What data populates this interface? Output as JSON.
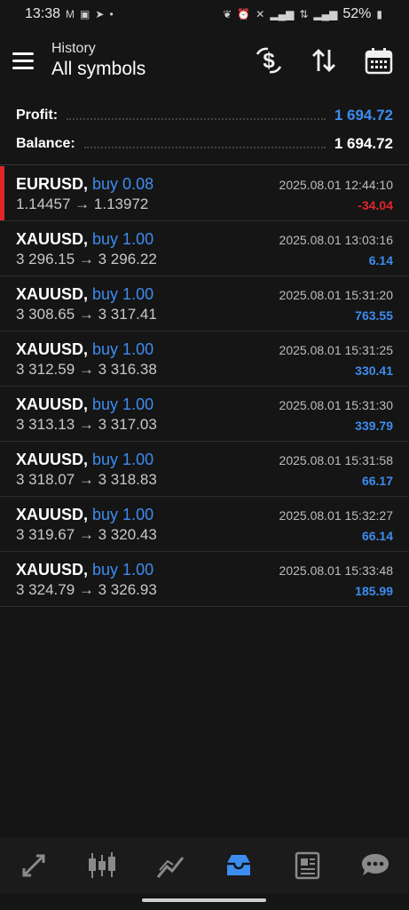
{
  "status_bar": {
    "time": "13:38",
    "battery": "52%",
    "left_icons": [
      "gmail-icon",
      "fxs-icon",
      "telegram-icon",
      "dot-icon"
    ],
    "right_icons": [
      "leaf-icon",
      "alarm-icon",
      "mute-icon",
      "signal-icon",
      "volte-icon",
      "4g-icon",
      "signal-icon",
      "battery-icon"
    ]
  },
  "header": {
    "subtitle": "History",
    "title": "All symbols",
    "actions": [
      "currency-swap-icon",
      "sort-icon",
      "calendar-icon"
    ]
  },
  "summary": {
    "profit_label": "Profit:",
    "profit_value": "1 694.72",
    "balance_label": "Balance:",
    "balance_value": "1 694.72"
  },
  "colors": {
    "positive": "#3d8cf0",
    "negative": "#e0262a",
    "background": "#151515"
  },
  "trades": [
    {
      "symbol": "EURUSD,",
      "side": "buy 0.08",
      "time": "2025.08.01 12:44:10",
      "prices": "1.14457 → 1.13972",
      "profit": "-34.04",
      "negative": true
    },
    {
      "symbol": "XAUUSD,",
      "side": "buy 1.00",
      "time": "2025.08.01 13:03:16",
      "prices": "3 296.15 → 3 296.22",
      "profit": "6.14",
      "negative": false
    },
    {
      "symbol": "XAUUSD,",
      "side": "buy 1.00",
      "time": "2025.08.01 15:31:20",
      "prices": "3 308.65 → 3 317.41",
      "profit": "763.55",
      "negative": false
    },
    {
      "symbol": "XAUUSD,",
      "side": "buy 1.00",
      "time": "2025.08.01 15:31:25",
      "prices": "3 312.59 → 3 316.38",
      "profit": "330.41",
      "negative": false
    },
    {
      "symbol": "XAUUSD,",
      "side": "buy 1.00",
      "time": "2025.08.01 15:31:30",
      "prices": "3 313.13 → 3 317.03",
      "profit": "339.79",
      "negative": false
    },
    {
      "symbol": "XAUUSD,",
      "side": "buy 1.00",
      "time": "2025.08.01 15:31:58",
      "prices": "3 318.07 → 3 318.83",
      "profit": "66.17",
      "negative": false
    },
    {
      "symbol": "XAUUSD,",
      "side": "buy 1.00",
      "time": "2025.08.01 15:32:27",
      "prices": "3 319.67 → 3 320.43",
      "profit": "66.14",
      "negative": false
    },
    {
      "symbol": "XAUUSD,",
      "side": "buy 1.00",
      "time": "2025.08.01 15:33:48",
      "prices": "3 324.79 → 3 326.93",
      "profit": "185.99",
      "negative": false
    }
  ],
  "bottom_nav": {
    "items": [
      "quotes-icon",
      "chart-icon",
      "trade-icon",
      "history-icon",
      "news-icon",
      "chat-icon"
    ],
    "active": "history-icon"
  }
}
